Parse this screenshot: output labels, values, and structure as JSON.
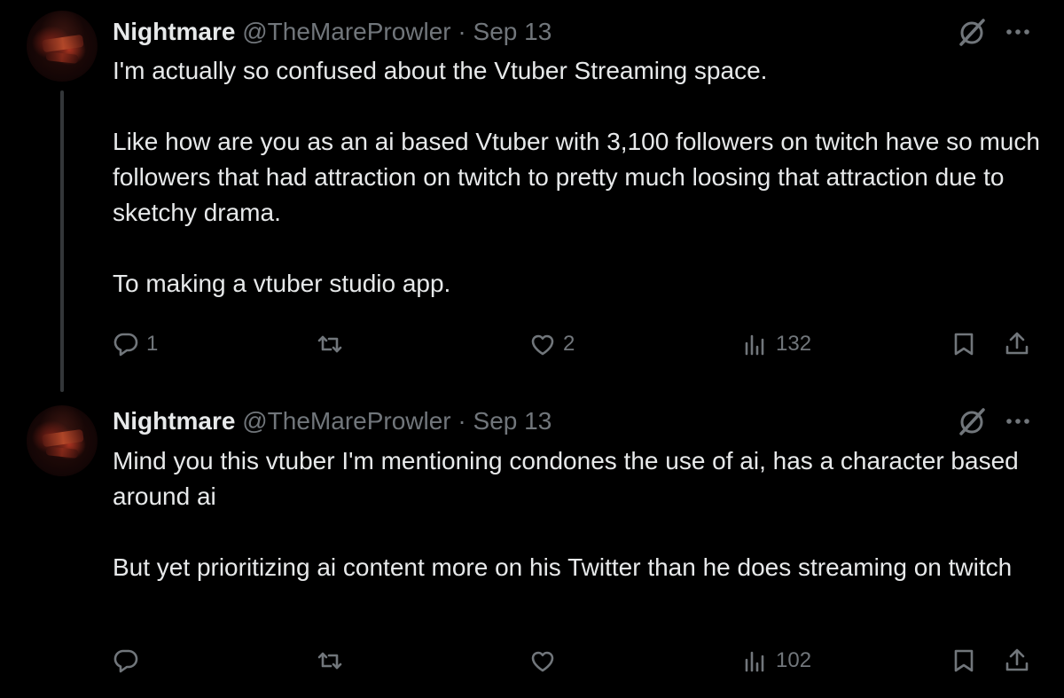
{
  "tweets": [
    {
      "name": "Nightmare",
      "handle": "@TheMareProwler",
      "separator": "·",
      "date": "Sep 13",
      "paragraphs": [
        "I'm actually so confused about the Vtuber Streaming space.",
        "Like how are you as an ai based Vtuber with 3,100 followers on twitch have so much followers that had attraction on twitch to pretty much loosing that attraction due to sketchy drama.",
        "To making a vtuber studio app."
      ],
      "replies": "1",
      "retweets": "",
      "likes": "2",
      "views": "132"
    },
    {
      "name": "Nightmare",
      "handle": "@TheMareProwler",
      "separator": "·",
      "date": "Sep 13",
      "paragraphs": [
        "Mind you this vtuber I'm mentioning condones the use of ai, has a character based around ai",
        "But yet prioritizing ai content more on his Twitter than he does streaming on twitch"
      ],
      "replies": "",
      "retweets": "",
      "likes": "",
      "views": "102"
    }
  ],
  "icons": {
    "reply": "reply-icon",
    "retweet": "retweet-icon",
    "like": "heart-icon",
    "views": "analytics-icon",
    "bookmark": "bookmark-icon",
    "share": "share-icon",
    "grok": "grok-icon",
    "more": "more-icon"
  },
  "colors": {
    "background": "#000000",
    "text": "#e7e9ea",
    "muted": "#71767b",
    "thread_line": "#333639"
  }
}
